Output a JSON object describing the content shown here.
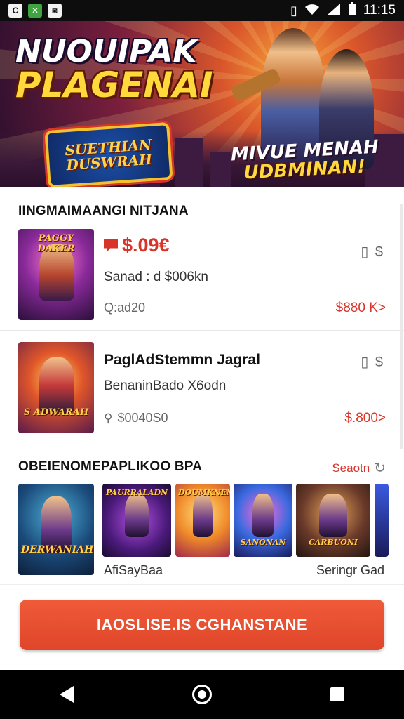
{
  "status_bar": {
    "app_icons": [
      "C",
      "✕",
      "◙"
    ],
    "time": "11:15"
  },
  "banner": {
    "title_line1": "NUOUIPAK",
    "title_line2": "PLAGENAI",
    "badge_line1": "SUETHIAN",
    "badge_line2": "DUSWRAH",
    "tag_line1": "MIVUE MENAH",
    "tag_line2": "UDBMINAN!"
  },
  "featured": {
    "section_title": "IINGMAIMAANGI NITJANA",
    "items": [
      {
        "thumb_caption": "PAGGY DAKER",
        "price": "$.09€",
        "subtitle": "Sanad : d $006kn",
        "meta": "Q:ad20",
        "right_icons": "▯ $",
        "right_price": "$880 K>"
      },
      {
        "thumb_caption": "S ADWARAH",
        "title": "PaglAdStemmn Jagral",
        "subtitle": "BenaninBado X6odn",
        "meta": "$0040S0",
        "right_icons": "▯ $",
        "right_price": "$.800>"
      }
    ]
  },
  "carousel": {
    "section_title": "OBEIENOMEPAPLIKOO BPA",
    "see_all": "Seaotn",
    "cards": [
      {
        "caption": "DERWANIAH"
      },
      {
        "caption": "PAURRALADN"
      },
      {
        "caption": "DOUMKNEN"
      },
      {
        "caption": "SANONAN"
      },
      {
        "caption": "CARBUONI"
      },
      {
        "caption": ""
      }
    ],
    "label_left": "AfiSayBaa",
    "label_right": "Seringr Gad"
  },
  "cta": {
    "label": "IAOSLISE.IS CGHANSTANE"
  },
  "colors": {
    "accent": "#e24a2c",
    "price_red": "#d8342a"
  }
}
